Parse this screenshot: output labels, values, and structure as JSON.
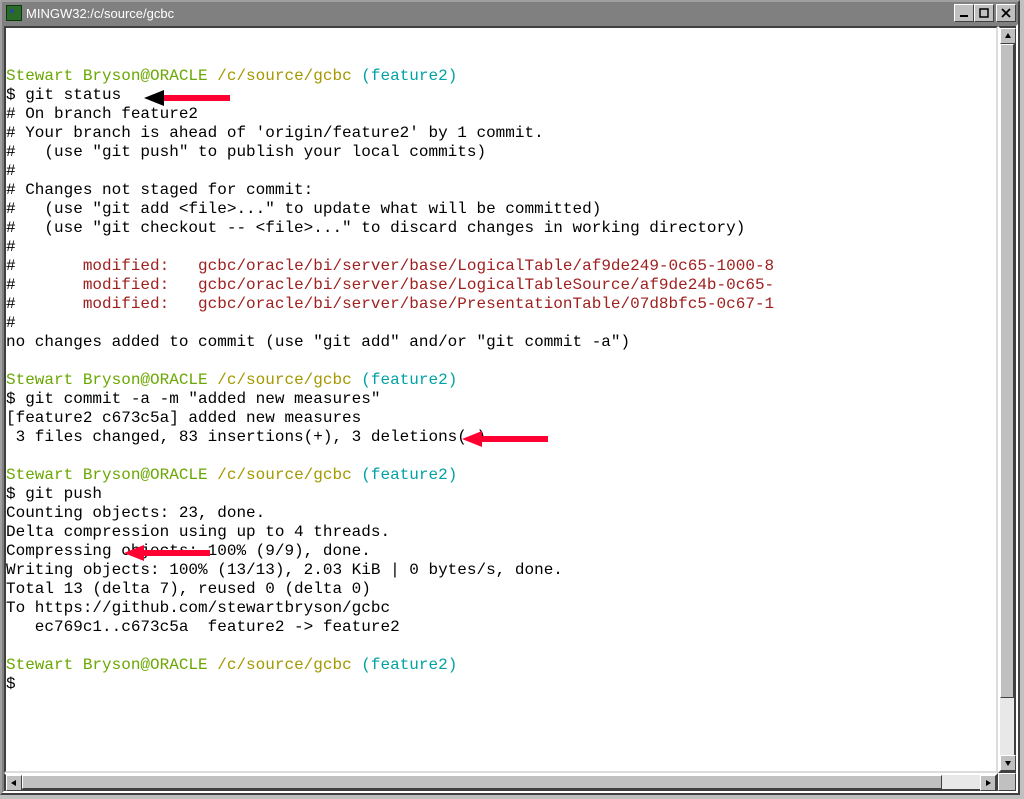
{
  "window": {
    "title": "MINGW32:/c/source/gcbc"
  },
  "prompt": {
    "userhost": "Stewart Bryson@ORACLE",
    "path": "/c/source/gcbc",
    "branch": "(feature2)"
  },
  "block1": {
    "cmd": "$ git status",
    "l1": "# On branch feature2",
    "l2": "# Your branch is ahead of 'origin/feature2' by 1 commit.",
    "l3": "#   (use \"git push\" to publish your local commits)",
    "l4": "#",
    "l5": "# Changes not staged for commit:",
    "l6": "#   (use \"git add <file>...\" to update what will be committed)",
    "l7": "#   (use \"git checkout -- <file>...\" to discard changes in working directory)",
    "l8": "#",
    "m_label": "modified:",
    "m1_path": "gcbc/oracle/bi/server/base/LogicalTable/af9de249-0c65-1000-8",
    "m2_path": "gcbc/oracle/bi/server/base/LogicalTableSource/af9de24b-0c65-",
    "m3_path": "gcbc/oracle/bi/server/base/PresentationTable/07d8bfc5-0c67-1",
    "l12": "#",
    "l13": "no changes added to commit (use \"git add\" and/or \"git commit -a\")"
  },
  "block2": {
    "cmd": "$ git commit -a -m \"added new measures\"",
    "l1": "[feature2 c673c5a] added new measures",
    "l2": " 3 files changed, 83 insertions(+), 3 deletions(-)"
  },
  "block3": {
    "cmd": "$ git push",
    "l1": "Counting objects: 23, done.",
    "l2": "Delta compression using up to 4 threads.",
    "l3": "Compressing objects: 100% (9/9), done.",
    "l4": "Writing objects: 100% (13/13), 2.03 KiB | 0 bytes/s, done.",
    "l5": "Total 13 (delta 7), reused 0 (delta 0)",
    "l6": "To https://github.com/stewartbryson/gcbc",
    "l7": "   ec769c1..c673c5a  feature2 -> feature2"
  },
  "final_prompt": "$",
  "colors": {
    "green": "#6aa701",
    "yellow": "#a39800",
    "cyan": "#00a2a3",
    "red": "#a02020",
    "arrow": "#ff0033"
  }
}
